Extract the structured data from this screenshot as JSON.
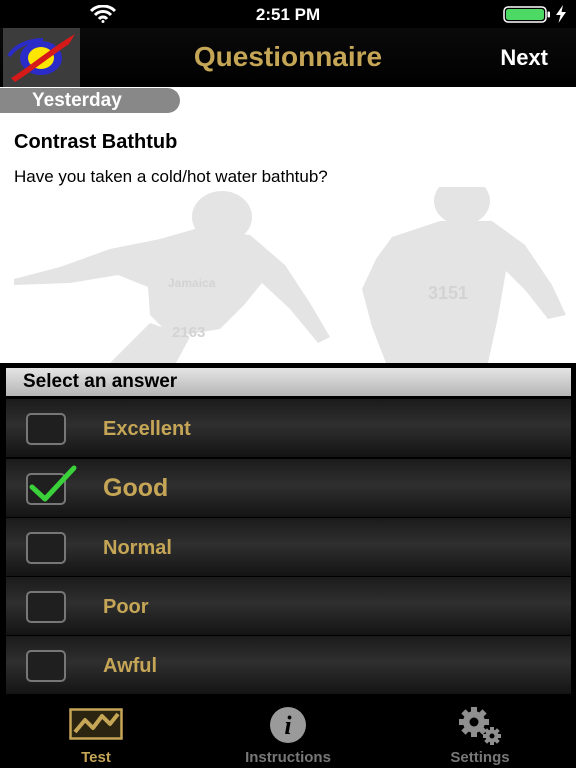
{
  "status_bar": {
    "time": "2:51 PM",
    "icons": [
      "wifi-icon",
      "battery-icon",
      "charging-bolt-icon"
    ]
  },
  "nav": {
    "title": "Questionnaire",
    "next_label": "Next",
    "logo": "app-logo-icon"
  },
  "question": {
    "day": "Yesterday",
    "title": "Contrast Bathtub",
    "text": "Have you taken a cold/hot water bathtub?"
  },
  "answers": {
    "header": "Select an answer",
    "options": [
      {
        "label": "Excellent",
        "selected": false
      },
      {
        "label": "Good",
        "selected": true
      },
      {
        "label": "Normal",
        "selected": false
      },
      {
        "label": "Poor",
        "selected": false
      },
      {
        "label": "Awful",
        "selected": false
      }
    ]
  },
  "tabs": [
    {
      "label": "Test",
      "icon": "chart-icon",
      "active": true
    },
    {
      "label": "Instructions",
      "icon": "info-icon",
      "active": false
    },
    {
      "label": "Settings",
      "icon": "gears-icon",
      "active": false
    }
  ],
  "colors": {
    "accent_gold": "#c5a556",
    "inactive_gray": "#777777",
    "check_green": "#3ad13a",
    "battery_green": "#4cd964"
  }
}
